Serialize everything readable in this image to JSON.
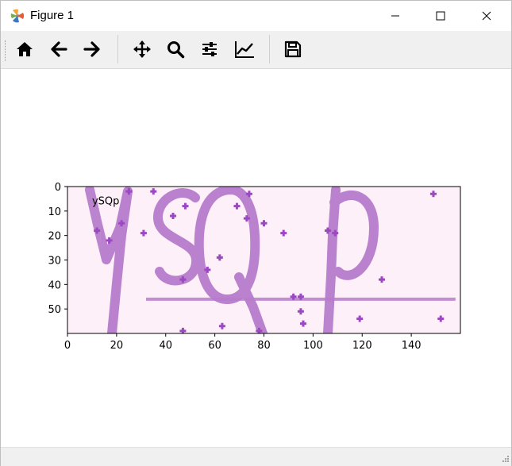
{
  "window": {
    "title": "Figure 1"
  },
  "window_controls": [
    "minimize",
    "maximize",
    "close"
  ],
  "toolbar": {
    "buttons": [
      {
        "name": "home",
        "icon": "home-icon"
      },
      {
        "name": "back",
        "icon": "arrow-left-icon"
      },
      {
        "name": "forward",
        "icon": "arrow-right-icon"
      },
      {
        "name": "pan",
        "icon": "move-icon"
      },
      {
        "name": "zoom",
        "icon": "zoom-icon"
      },
      {
        "name": "configure-subplots",
        "icon": "sliders-icon"
      },
      {
        "name": "edit-axis",
        "icon": "line-chart-icon"
      },
      {
        "name": "save",
        "icon": "floppy-disk-icon"
      }
    ]
  },
  "figure": {
    "annotation": "ySQp",
    "background_color": "#fdf0f8",
    "ink_color": "#b77dcc",
    "dot_color": "#9c48c2"
  },
  "chart_data": {
    "type": "image",
    "xlim": [
      0,
      160
    ],
    "ylim": [
      60,
      0
    ],
    "xticks": [
      0,
      20,
      40,
      60,
      80,
      100,
      120,
      140
    ],
    "yticks": [
      0,
      10,
      20,
      30,
      40,
      50
    ],
    "xtick_labels": [
      "0",
      "20",
      "40",
      "60",
      "80",
      "100",
      "120",
      "140"
    ],
    "ytick_labels": [
      "0",
      "10",
      "20",
      "30",
      "40",
      "50"
    ],
    "annotations": [
      {
        "text": "ySQp",
        "x": 10,
        "y": 6
      }
    ],
    "noise_line": {
      "x": [
        32,
        158
      ],
      "y": [
        46,
        46
      ]
    },
    "noise_dots": [
      [
        12,
        18
      ],
      [
        17,
        22
      ],
      [
        22,
        15
      ],
      [
        25,
        2
      ],
      [
        35,
        2
      ],
      [
        31,
        19
      ],
      [
        43,
        12
      ],
      [
        48,
        8
      ],
      [
        47,
        38
      ],
      [
        57,
        34
      ],
      [
        62,
        29
      ],
      [
        69,
        8
      ],
      [
        74,
        3
      ],
      [
        73,
        13
      ],
      [
        80,
        15
      ],
      [
        88,
        19
      ],
      [
        92,
        45
      ],
      [
        95,
        45
      ],
      [
        95,
        51
      ],
      [
        96,
        56
      ],
      [
        106,
        18
      ],
      [
        109,
        19
      ],
      [
        119,
        54
      ],
      [
        128,
        38
      ],
      [
        149,
        3
      ],
      [
        152,
        54
      ],
      [
        47,
        59
      ],
      [
        63,
        57
      ],
      [
        78,
        59
      ]
    ]
  }
}
